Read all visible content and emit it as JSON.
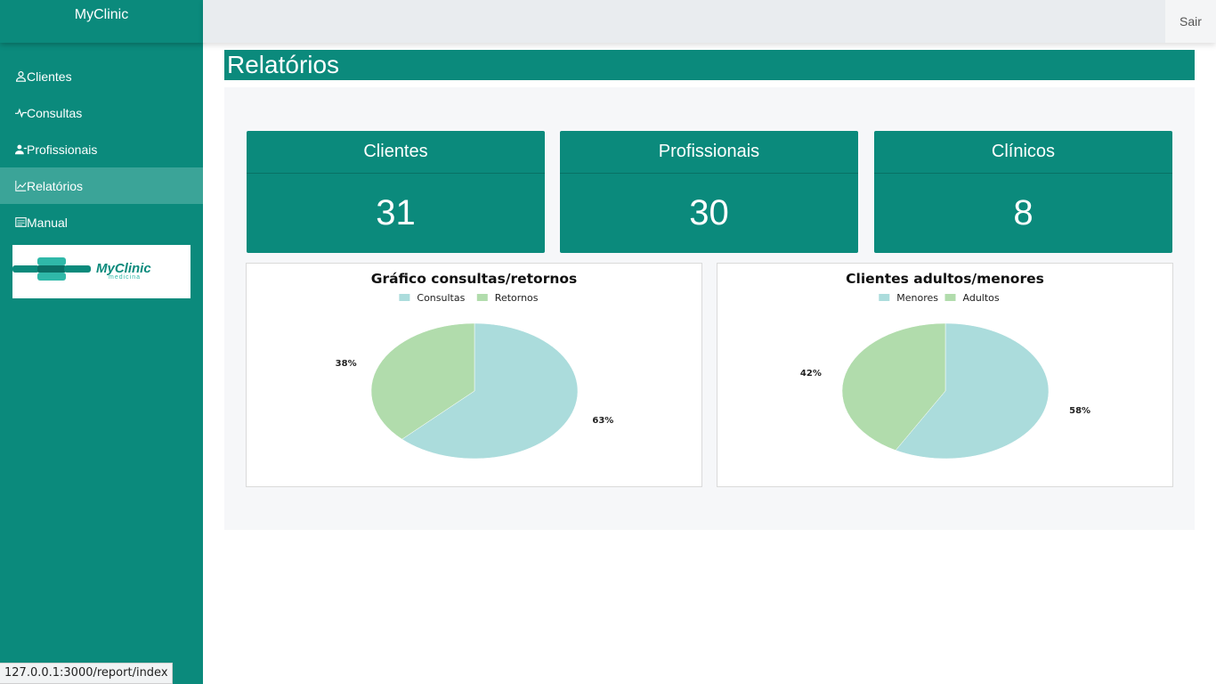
{
  "app": {
    "title": "MyClinic"
  },
  "sidebar": {
    "items": [
      {
        "label": "Clientes",
        "icon": "person-icon",
        "active": false
      },
      {
        "label": "Consultas",
        "icon": "pulse-icon",
        "active": false
      },
      {
        "label": "Profissionais",
        "icon": "user-plus-icon",
        "active": false
      },
      {
        "label": "Relatórios",
        "icon": "chart-line-icon",
        "active": true
      },
      {
        "label": "Manual",
        "icon": "document-icon",
        "active": false
      }
    ],
    "logo": {
      "name": "MyClinic",
      "sub": "medicina"
    }
  },
  "topbar": {
    "logout_label": "Sair"
  },
  "page": {
    "title": "Relatórios"
  },
  "stats": [
    {
      "label": "Clientes",
      "value": "31"
    },
    {
      "label": "Profissionais",
      "value": "30"
    },
    {
      "label": "Clínicos",
      "value": "8"
    }
  ],
  "colors": {
    "primary": "#0b8a7c",
    "active": "#3ba498",
    "slice_a": "#abdcdc",
    "slice_b": "#b1dcac"
  },
  "chart_data": [
    {
      "type": "pie",
      "title": "Gráfico consultas/retornos",
      "categories": [
        "Consultas",
        "Retornos"
      ],
      "values": [
        63,
        38
      ],
      "labels": [
        "63%",
        "38%"
      ],
      "colors": [
        "#abdcdc",
        "#b1dcac"
      ],
      "legend": "top"
    },
    {
      "type": "pie",
      "title": "Clientes adultos/menores",
      "categories": [
        "Menores",
        "Adultos"
      ],
      "values": [
        58,
        42
      ],
      "labels": [
        "58%",
        "42%"
      ],
      "colors": [
        "#abdcdc",
        "#b1dcac"
      ],
      "legend": "top"
    }
  ],
  "status_url": "127.0.0.1:3000/report/index"
}
